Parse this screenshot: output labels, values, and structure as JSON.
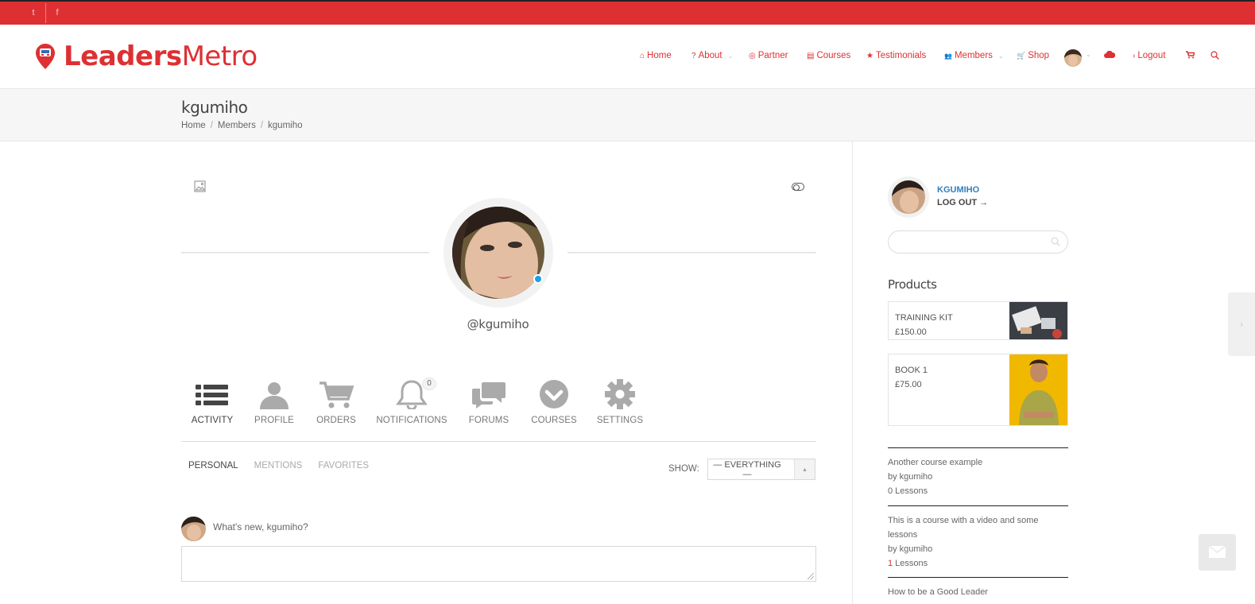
{
  "social": {
    "twitter_icon": "twitter-icon",
    "facebook_icon": "facebook-icon",
    "twitter": "t",
    "facebook": "f"
  },
  "brand": {
    "part1": "Leaders",
    "part2": "Metro",
    "accent": "#de3033"
  },
  "nav": [
    {
      "label": "Home",
      "icon": "home-icon",
      "glyph": "⌂"
    },
    {
      "label": "About",
      "icon": "question-icon",
      "glyph": "?",
      "caret": true
    },
    {
      "label": "Partner",
      "icon": "dribbble-icon",
      "glyph": "◎"
    },
    {
      "label": "Courses",
      "icon": "book-icon",
      "glyph": "▤"
    },
    {
      "label": "Testimonials",
      "icon": "star-icon",
      "glyph": "★"
    },
    {
      "label": "Members",
      "icon": "users-icon",
      "glyph": "👥",
      "caret": true
    },
    {
      "label": "Shop",
      "icon": "cart-icon",
      "glyph": "🛒"
    },
    {
      "label": "Logout",
      "icon": "chevron-right-icon",
      "glyph": "›"
    }
  ],
  "page": {
    "title": "kgumiho",
    "breadcrumb": [
      "Home",
      "Members",
      "kgumiho"
    ],
    "breadcrumb_sep": "/"
  },
  "profile": {
    "handle": "@kgumiho",
    "tabs": [
      {
        "label": "ACTIVITY",
        "icon": "list-icon"
      },
      {
        "label": "PROFILE",
        "icon": "user-icon"
      },
      {
        "label": "ORDERS",
        "icon": "cart-icon"
      },
      {
        "label": "NOTIFICATIONS",
        "icon": "bell-icon",
        "badge": "0"
      },
      {
        "label": "FORUMS",
        "icon": "comments-icon"
      },
      {
        "label": "COURSES",
        "icon": "chevron-circle-icon"
      },
      {
        "label": "SETTINGS",
        "icon": "gear-icon"
      }
    ],
    "subtabs": [
      "PERSONAL",
      "MENTIONS",
      "FAVORITES"
    ],
    "show_label": "SHOW:",
    "show_value": "— EVERYTHING —",
    "post_prompt": "What's new, kgumiho?"
  },
  "sidebar": {
    "username": "KGUMIHO",
    "logout": "LOG OUT →",
    "products_heading": "Products",
    "products": [
      {
        "name": "TRAINING KIT",
        "price": "£150.00"
      },
      {
        "name": "BOOK 1",
        "price": "£75.00"
      }
    ],
    "courses": [
      {
        "title": "Another course example",
        "by": "by kgumiho",
        "lessons_count": "0",
        "lessons_label": " Lessons"
      },
      {
        "title": "This is a course with a video and some lessons",
        "by": "by kgumiho",
        "lessons_count": "1",
        "lessons_label": " Lessons"
      },
      {
        "title": "How to be a Good Leader"
      }
    ]
  }
}
